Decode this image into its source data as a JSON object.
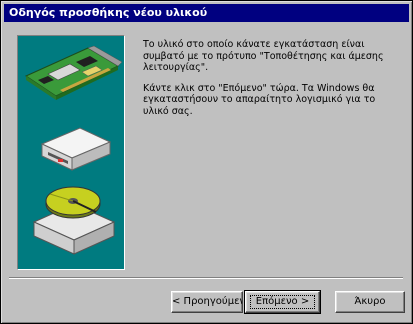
{
  "window": {
    "title": "Οδηγός προσθήκης νέου υλικού"
  },
  "main": {
    "paragraphs": [
      "Το υλικό στο οποίο κάνατε εγκατάσταση είναι συμβατό με το πρότυπο \"Τοποθέτησης και άμεσης λειτουργίας\".",
      "Κάντε κλικ στο \"Επόμενο\" τώρα. Τα Windows θα εγκαταστήσουν το απαραίτητο λογισμικό για το υλικό σας."
    ]
  },
  "sidebar": {
    "illustrations": [
      "expansion-card-icon",
      "disk-drive-icon",
      "hard-disk-icon"
    ],
    "background_color": "#007b80"
  },
  "buttons": {
    "back_label": "< Προηγούμενο",
    "next_label": "Επόμενο >",
    "cancel_label": "Άκυρο"
  }
}
